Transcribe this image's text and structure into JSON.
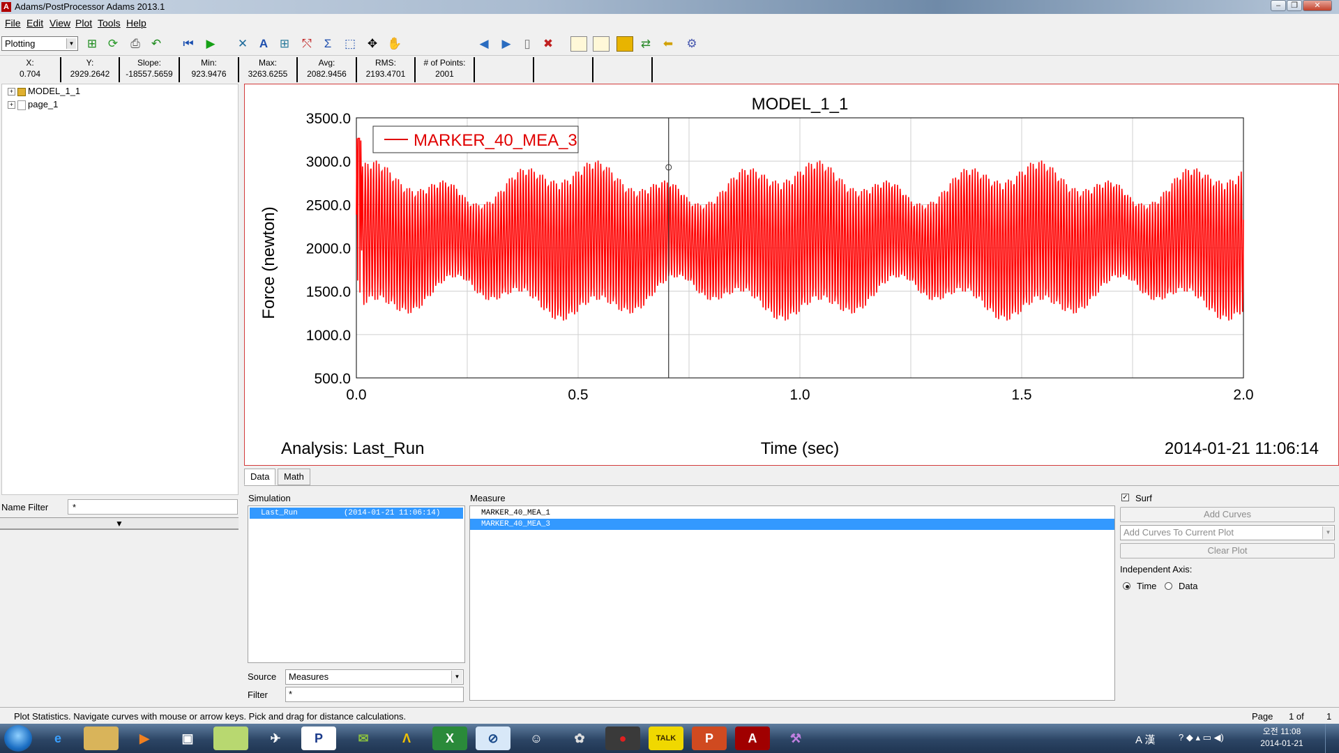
{
  "window": {
    "title": "Adams/PostProcessor Adams 2013.1",
    "app_icon": "A"
  },
  "menu": [
    "File",
    "Edit",
    "View",
    "Plot",
    "Tools",
    "Help"
  ],
  "toolbar": {
    "mode": "Plotting",
    "icons": [
      "new-page-icon",
      "refresh-icon",
      "print-icon",
      "undo-icon",
      "rewind-icon",
      "play-icon",
      "wrench-icon",
      "text-tool-icon",
      "grid-icon",
      "curve-edit-icon",
      "sigma-icon",
      "zoom-box-icon",
      "fit-icon",
      "pan-hand-icon",
      "prev-page-icon",
      "next-page-icon",
      "page-icon",
      "delete-page-icon",
      "layout-icon",
      "layout-bottom-icon",
      "layout-box-icon",
      "exchange-icon",
      "arrow-icon",
      "settings-icon"
    ]
  },
  "stats": [
    {
      "label": "X:",
      "value": "0.704"
    },
    {
      "label": "Y:",
      "value": "2929.2642"
    },
    {
      "label": "Slope:",
      "value": "-18557.5659"
    },
    {
      "label": "Min:",
      "value": "923.9476"
    },
    {
      "label": "Max:",
      "value": "3263.6255"
    },
    {
      "label": "Avg:",
      "value": "2082.9456"
    },
    {
      "label": "RMS:",
      "value": "2193.4701"
    },
    {
      "label": "# of Points:",
      "value": "2001"
    }
  ],
  "tree": {
    "items": [
      {
        "label": "MODEL_1_1",
        "icon": "model-icon"
      },
      {
        "label": "page_1",
        "icon": "page-icon"
      }
    ],
    "name_filter_label": "Name Filter",
    "name_filter_value": "*"
  },
  "plot": {
    "title": "MODEL_1_1",
    "ylabel": "Force (newton)",
    "xlabel": "Time (sec)",
    "analysis": "Analysis:  Last_Run",
    "timestamp": "2014-01-21 11:06:14",
    "legend": "MARKER_40_MEA_3",
    "xticks": [
      "0.0",
      "0.5",
      "1.0",
      "1.5",
      "2.0"
    ],
    "yticks": [
      "3500.0",
      "3000.0",
      "2500.0",
      "2000.0",
      "1500.0",
      "1000.0",
      "500.0"
    ]
  },
  "chart_data": {
    "type": "line",
    "title": "MODEL_1_1",
    "xlabel": "Time (sec)",
    "ylabel": "Force (newton)",
    "xlim": [
      0.0,
      2.0
    ],
    "ylim": [
      500.0,
      3500.0
    ],
    "grid": true,
    "legend_position": "top-left",
    "series": [
      {
        "name": "MARKER_40_MEA_3",
        "color": "#ff0000",
        "points_count": 2001,
        "min": 923.9476,
        "max": 3263.6255,
        "avg": 2082.9456,
        "cursor": {
          "x": 0.704,
          "y": 2929.2642
        }
      }
    ]
  },
  "bottom": {
    "tabs": [
      "Data",
      "Math"
    ],
    "simulation_label": "Simulation",
    "simulation_item_name": "Last_Run",
    "simulation_item_time": "(2014-01-21 11:06:14)",
    "measure_label": "Measure",
    "measures": [
      "MARKER_40_MEA_1",
      "MARKER_40_MEA_3"
    ],
    "source_label": "Source",
    "source_value": "Measures",
    "filter_label": "Filter",
    "filter_value": "*",
    "surf_label": "Surf",
    "add_curves": "Add Curves",
    "add_to_plot": "Add Curves To Current Plot",
    "clear_plot": "Clear Plot",
    "independent_axis_label": "Independent Axis:",
    "axis_time": "Time",
    "axis_data": "Data"
  },
  "status": {
    "message": "Plot Statistics.  Navigate curves with mouse or arrow keys.  Pick and drag for distance calculations.",
    "page_label": "Page",
    "page_current": "1 of",
    "page_total": "1"
  },
  "taskbar": {
    "time": "오전 11:08",
    "date": "2014-01-21",
    "tray_text": "A 漢",
    "apps": [
      "ie-icon",
      "explorer-icon",
      "media-player-icon",
      "window-icon",
      "notepad-icon",
      "app-icon",
      "powerpoint-viewer-icon",
      "chat-icon",
      "autocad-icon",
      "excel-icon",
      "tool-icon",
      "mascot-icon",
      "network-icon",
      "recorder-icon",
      "talk-icon",
      "powerpoint-icon",
      "adams-icon",
      "tools-icon"
    ],
    "adams_label": "A",
    "talk_label": "TALK",
    "ppt_label": "P"
  }
}
